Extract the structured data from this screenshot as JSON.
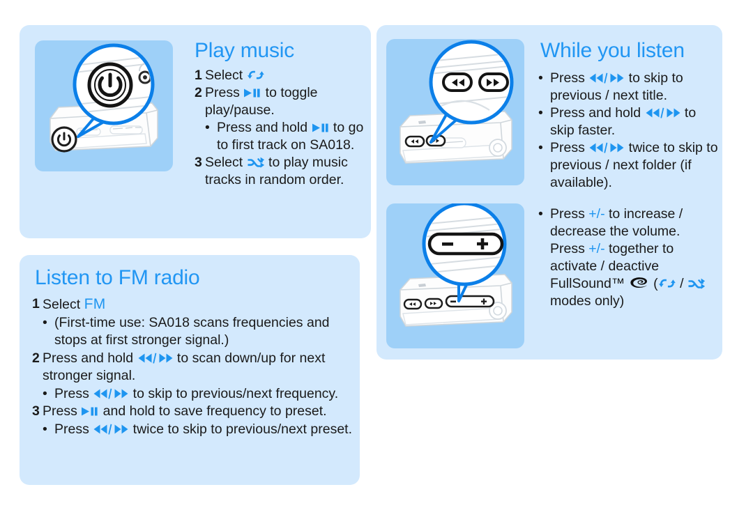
{
  "colors": {
    "panel_bg": "#d3e9fd",
    "imagebox_bg": "#9ed0f8",
    "accent_blue": "#2196f3",
    "icon_blue": "#1e95f0",
    "text": "#1a1a1a",
    "page_bg": "#ffffff"
  },
  "sections": {
    "play_music": {
      "heading": "Play music",
      "steps": [
        {
          "num": "1",
          "pre": "Select ",
          "icon": "repeat-icon",
          "post": ""
        },
        {
          "num": "2",
          "pre": "Press ",
          "icon": "play-pause-icon",
          "post": " to toggle play/pause."
        },
        {
          "bullet": "•",
          "pre": "Press and hold ",
          "icon": "play-pause-icon",
          "post": " to go to first track on SA018."
        },
        {
          "num": "3",
          "pre": "Select ",
          "icon": "shuffle-icon",
          "post": " to play music tracks in random order."
        }
      ]
    },
    "while_you_listen": {
      "heading": "While you listen",
      "bullets_group1": [
        {
          "bullet": "•",
          "pre": "Press ",
          "icon": "prev-next-icon",
          "post": " to skip to previous / next title."
        },
        {
          "bullet": "•",
          "pre": "Press and hold ",
          "icon": "prev-next-icon",
          "post": " to skip faster."
        },
        {
          "bullet": "•",
          "pre": "Press ",
          "icon": "prev-next-icon",
          "post": " twice to skip to previous / next folder (if available)."
        }
      ],
      "bullets_group2": [
        {
          "bullet": "•",
          "line1_pre": "Press ",
          "line1_pm": "+/-",
          "line1_post": " to increase / decrease the volume. Press ",
          "line2_pm": "+/-",
          "line2_post": " together to activate / deactive FullSound™ ",
          "fullsound_icon": "fullsound-logo-icon",
          "paren_open": " (",
          "icon_repeat": "repeat-icon",
          "slash": " / ",
          "icon_shuffle": "shuffle-icon",
          "tail": " modes only)"
        }
      ]
    },
    "listen_fm_radio": {
      "heading": "Listen to FM radio",
      "steps": [
        {
          "num": "1",
          "pre": "Select ",
          "fm_word": "FM",
          "post": ""
        },
        {
          "bullet": "•",
          "pre": "(First-time use: SA018 scans frequencies and stops at first stronger signal.)"
        },
        {
          "num": "2",
          "pre": "Press and hold ",
          "icon": "prev-next-icon",
          "post": " to scan down/up for next stronger signal."
        },
        {
          "bullet": "•",
          "pre": "Press ",
          "icon": "prev-next-icon",
          "post": " to skip to previous/next frequency."
        },
        {
          "num": "3",
          "pre": "Press ",
          "icon": "play-pause-icon",
          "post": " and hold to save frequency to preset."
        },
        {
          "bullet": "•",
          "pre": "Press ",
          "icon": "prev-next-icon",
          "post": " twice to skip to previous/next preset."
        }
      ]
    }
  },
  "illustrations": {
    "power": {
      "name": "player-power-button-illustration",
      "callout_label": "power-button",
      "device_label": "SA018 music player"
    },
    "skip": {
      "name": "player-skip-buttons-illustration",
      "callout_label": "rewind-forward-buttons",
      "device_label": "SA018 music player"
    },
    "volume": {
      "name": "player-volume-buttons-illustration",
      "callout_label": "volume-plus-minus-button",
      "device_label": "SA018 music player"
    }
  }
}
